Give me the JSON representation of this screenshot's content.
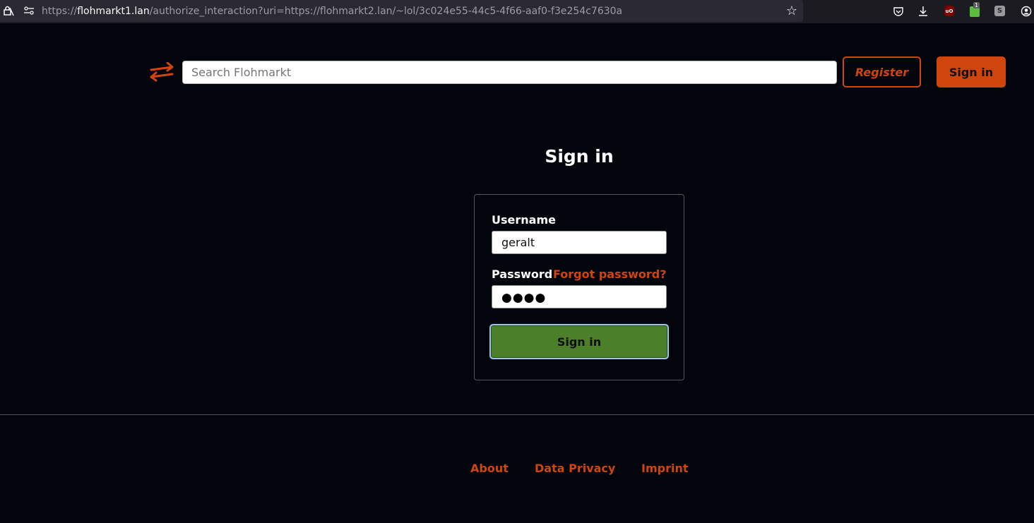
{
  "browser": {
    "url_prefix": "https://",
    "url_host": "flohmarkt1.lan",
    "url_path": "/authorize_interaction?uri=https://flohmarkt2.lan/~lol/3c024e55-44c5-4f66-aaf0-f3e254c7630a",
    "extension_badge": "1",
    "ublock_label": "uO",
    "s_ext_label": "S"
  },
  "header": {
    "search_placeholder": "Search Flohmarkt",
    "register_label": "Register",
    "signin_label": "Sign in"
  },
  "main": {
    "title": "Sign in",
    "form": {
      "username_label": "Username",
      "username_value": "geralt",
      "password_label": "Password",
      "password_mask": "●●●●",
      "forgot_label": "Forgot password?",
      "submit_label": "Sign in"
    }
  },
  "footer": {
    "links": [
      "About",
      "Data Privacy",
      "Imprint"
    ]
  },
  "colors": {
    "background": "#03050d",
    "accent": "#d0450e",
    "submit": "#4c7f2a"
  }
}
